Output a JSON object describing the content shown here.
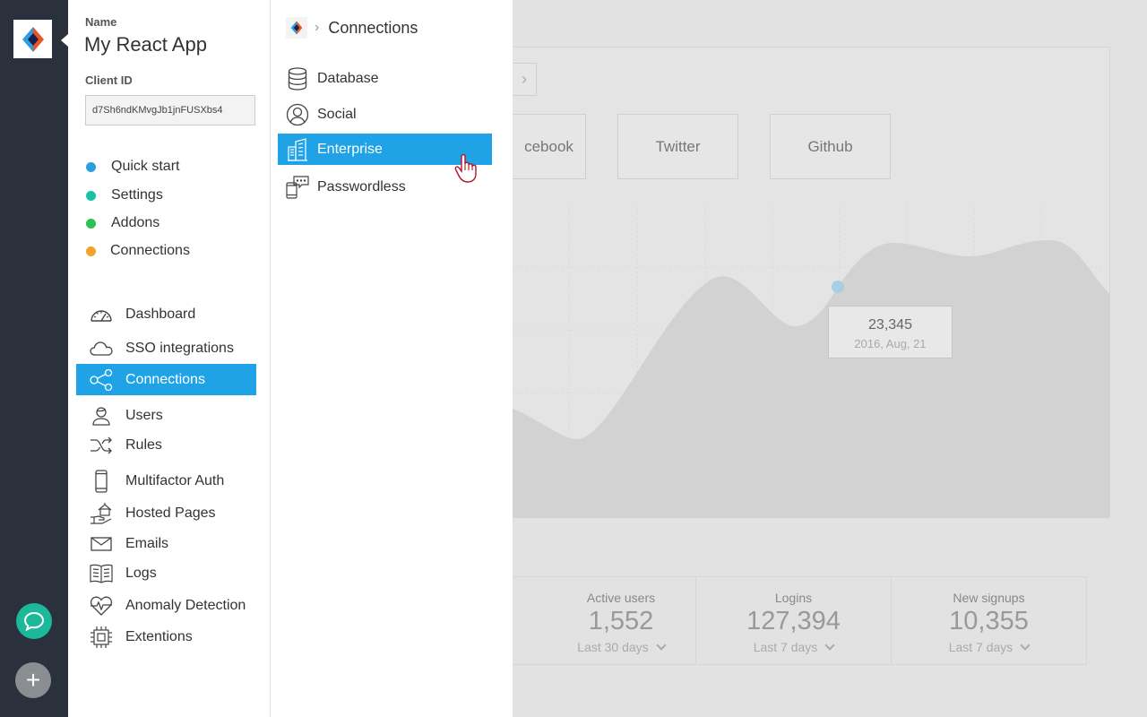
{
  "app": {
    "name_label": "Name",
    "name": "My React App",
    "client_id_label": "Client ID",
    "client_id": "d7Sh6ndKMvgJb1jnFUSXbs4"
  },
  "quick_links": [
    {
      "label": "Quick start",
      "color": "#2b9ee0"
    },
    {
      "label": "Settings",
      "color": "#16c3a5"
    },
    {
      "label": "Addons",
      "color": "#2ac255"
    },
    {
      "label": "Connections",
      "color": "#f0a42b"
    }
  ],
  "nav": [
    {
      "label": "Dashboard",
      "icon": "gauge-icon"
    },
    {
      "label": "SSO integrations",
      "icon": "cloud-icon"
    },
    {
      "label": "Connections",
      "icon": "share-nodes-icon",
      "active": true
    },
    {
      "label": "Users",
      "icon": "user-icon"
    },
    {
      "label": "Rules",
      "icon": "shuffle-icon"
    },
    {
      "label": "Multifactor Auth",
      "icon": "phone-icon"
    },
    {
      "label": "Hosted Pages",
      "icon": "hand-house-icon"
    },
    {
      "label": "Emails",
      "icon": "envelope-icon"
    },
    {
      "label": "Logs",
      "icon": "book-icon"
    },
    {
      "label": "Anomaly Detection",
      "icon": "heart-pulse-icon"
    },
    {
      "label": "Extentions",
      "icon": "chip-icon"
    }
  ],
  "submenu": {
    "title": "Connections",
    "items": [
      {
        "label": "Database",
        "icon": "database-icon"
      },
      {
        "label": "Social",
        "icon": "person-circle-icon"
      },
      {
        "label": "Enterprise",
        "icon": "buildings-icon",
        "active": true
      },
      {
        "label": "Passwordless",
        "icon": "phone-chat-icon"
      }
    ]
  },
  "background": {
    "social_buttons": [
      "cebook",
      "Twitter",
      "Github"
    ],
    "tooltip": {
      "value": "23,345",
      "date": "2016, Aug, 21"
    },
    "stats": [
      {
        "label": "Active users",
        "value": "1,552",
        "period": "Last 30 days"
      },
      {
        "label": "Logins",
        "value": "127,394",
        "period": "Last 7 days"
      },
      {
        "label": "New signups",
        "value": "10,355",
        "period": "Last 7 days"
      }
    ]
  },
  "colors": {
    "rail": "#2b313c",
    "accent": "#1fa3e6",
    "chat": "#1bb899"
  }
}
